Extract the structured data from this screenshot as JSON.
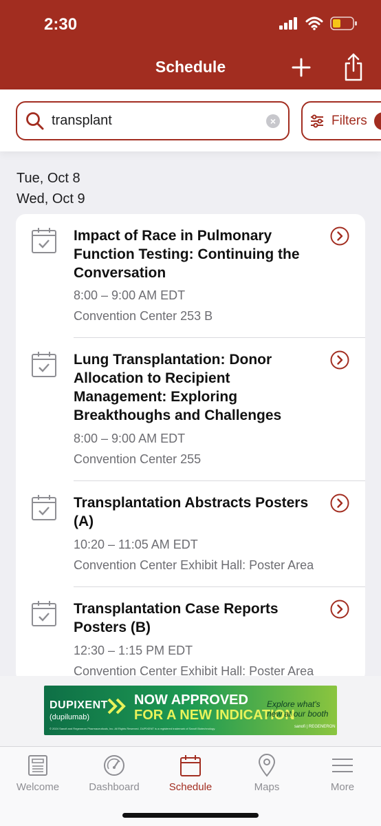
{
  "status_bar": {
    "time": "2:30"
  },
  "header": {
    "title": "Schedule"
  },
  "search": {
    "value": "transplant",
    "filters_label": "Filters"
  },
  "dates": [
    "Tue, Oct 8",
    "Wed, Oct 9"
  ],
  "sessions": [
    {
      "title": "Impact of Race in Pulmonary Function Testing: Continuing the Conversation",
      "time": "8:00 – 9:00 AM EDT",
      "location": "Convention Center 253 B"
    },
    {
      "title": "Lung Transplantation:  Donor Allocation to Recipient Management: Exploring Breakthoughs and Challenges",
      "time": "8:00 – 9:00 AM EDT",
      "location": "Convention Center 255"
    },
    {
      "title": "Transplantation Abstracts Posters (A)",
      "time": "10:20 – 11:05 AM EDT",
      "location": "Convention Center Exhibit Hall: Poster Area"
    },
    {
      "title": "Transplantation Case Reports Posters (B)",
      "time": "12:30 – 1:15 PM EDT",
      "location": "Convention Center Exhibit Hall: Poster Area"
    }
  ],
  "ad": {
    "brand": "DUPIXENT",
    "generic": "(dupilumab)",
    "headline_1": "NOW APPROVED",
    "headline_2": "FOR A NEW INDICATION",
    "cta": "Explore what's new at our booth",
    "fine_print": "© 2024 Sanofi and Regeneron Pharmaceuticals, Inc. All Rights Reserved. DUPIXENT is a registered trademark of Sanofi Biotechnology.",
    "sponsors": "sanofi | REGENERON"
  },
  "tabs": [
    {
      "label": "Welcome",
      "icon": "newspaper-icon"
    },
    {
      "label": "Dashboard",
      "icon": "gauge-icon"
    },
    {
      "label": "Schedule",
      "icon": "calendar-icon",
      "active": true
    },
    {
      "label": "Maps",
      "icon": "map-pin-icon"
    },
    {
      "label": "More",
      "icon": "menu-icon"
    }
  ],
  "colors": {
    "brand": "#a22d20",
    "ad_green": "#1e9a53",
    "ad_yellow": "#e8f35a"
  }
}
